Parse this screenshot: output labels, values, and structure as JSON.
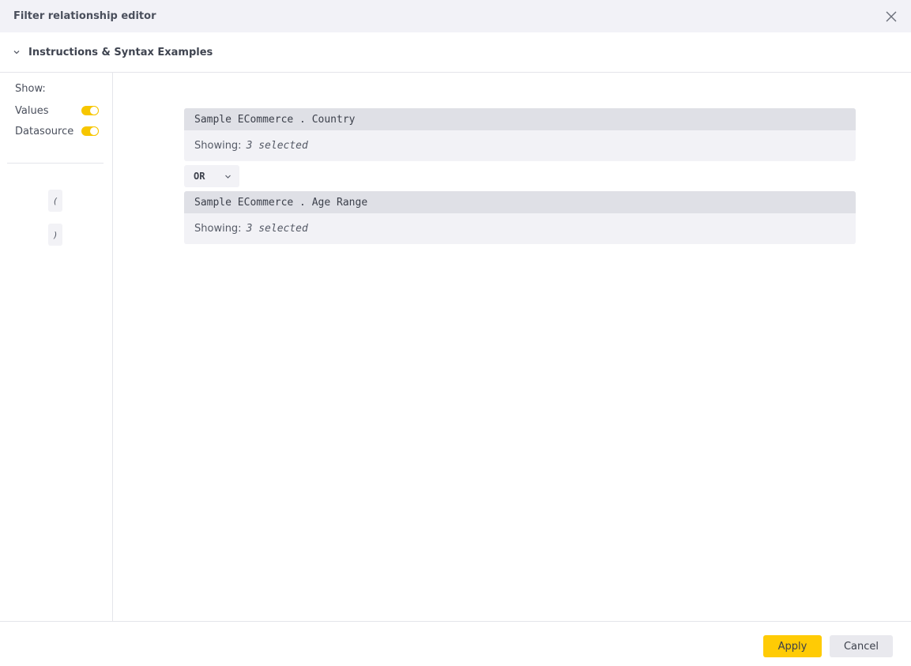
{
  "dialog": {
    "title": "Filter relationship editor"
  },
  "instructions": {
    "label": "Instructions & Syntax Examples"
  },
  "sidebar": {
    "show_label": "Show:",
    "toggles": [
      {
        "label": "Values",
        "on": true
      },
      {
        "label": "Datasource",
        "on": true
      }
    ],
    "open_paren": "(",
    "close_paren": ")"
  },
  "filters": [
    {
      "field": "Sample ECommerce . Country",
      "showing_label": "Showing:",
      "showing_value": "3 selected"
    },
    {
      "field": "Sample ECommerce . Age Range",
      "showing_label": "Showing:",
      "showing_value": "3 selected"
    }
  ],
  "operator": {
    "value": "OR"
  },
  "footer": {
    "apply_label": "Apply",
    "cancel_label": "Cancel"
  },
  "colors": {
    "accent": "#ffcb05",
    "toggle_on": "#f7c600"
  }
}
